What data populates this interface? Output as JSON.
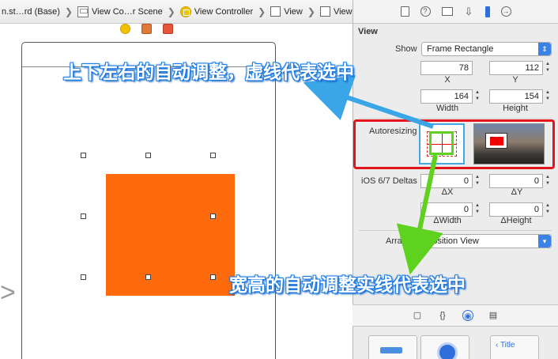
{
  "breadcrumb": {
    "items": [
      {
        "label": "n.st…rd (Base)",
        "icon": "storyboard-icon"
      },
      {
        "label": "View Co…r Scene",
        "icon": "scene-icon"
      },
      {
        "label": "View Controller",
        "icon": "view-controller-icon"
      },
      {
        "label": "View",
        "icon": "view-icon"
      },
      {
        "label": "View",
        "icon": "view-icon"
      }
    ],
    "separator": "❯"
  },
  "inspector": {
    "tabs": [
      "file-inspector-icon",
      "quick-help-icon",
      "identity-inspector-icon",
      "attributes-inspector-icon",
      "size-inspector-icon",
      "connections-inspector-icon"
    ],
    "section_title": "View",
    "show_label": "Show",
    "show_value": "Frame Rectangle",
    "x_value": "78",
    "y_value": "112",
    "x_label": "X",
    "y_label": "Y",
    "width_value": "164",
    "height_value": "154",
    "width_label": "Width",
    "height_label": "Height",
    "autoresizing_label": "Autoresizing",
    "ios_deltas_label": "iOS 6/7 Deltas",
    "delta_x_value": "0",
    "delta_y_value": "0",
    "delta_x_label": "ΔX",
    "delta_y_label": "ΔY",
    "delta_width_value": "0",
    "delta_height_value": "0",
    "delta_width_label": "ΔWidth",
    "delta_height_label": "ΔHeight",
    "arrange_label": "Arrange",
    "arrange_value": "Position View"
  },
  "library": {
    "tabs": [
      "file-template-icon",
      "code-snippet-icon",
      "object-library-icon",
      "media-library-icon"
    ],
    "nav_tile_label": "Title"
  },
  "annotations": {
    "top": "上下左右的自动调整，虚线代表选中",
    "bottom": "宽高的自动调整实线代表选中"
  },
  "colors": {
    "orange_view": "#ff6a0c",
    "annotation_outline": "#1d7be0",
    "highlight_red": "#e3141b",
    "arrow_blue": "#3aa6e8",
    "arrow_green": "#5fd21f"
  }
}
